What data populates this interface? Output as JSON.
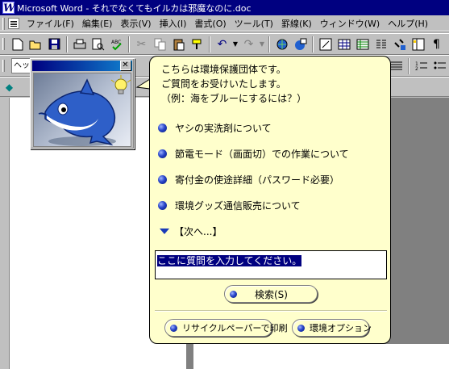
{
  "window": {
    "title": "Microsoft Word - それでなくてもイルカは邪魔なのに.doc",
    "app_icon": "W"
  },
  "menu": {
    "items": [
      "ファイル(F)",
      "編集(E)",
      "表示(V)",
      "挿入(I)",
      "書式(O)",
      "ツール(T)",
      "罫線(K)",
      "ウィンドウ(W)",
      "ヘルプ(H)"
    ]
  },
  "toolbar": {
    "style_value": "ヘッダ"
  },
  "balloon": {
    "intro_lines": [
      "こちらは環境保護団体です。",
      "ご質問をお受けいたします。",
      "（例：海をブルーにするには？）"
    ],
    "topics": [
      "ヤシの実洗剤について",
      "節電モード（画面切）での作業について",
      "寄付金の使途詳細（パスワード必要）",
      "環境グッズ通信販売について"
    ],
    "next_label": "【次へ...】",
    "question_input": "ここに質問を入力してください。",
    "search_label": "検索(S)",
    "print_label": "リサイクルペーパーで印刷",
    "options_label": "環境オプション"
  },
  "colors": {
    "title_bar": "#000080",
    "balloon_bg": "#ffffcc",
    "bullet": "#1a3bb8",
    "dolphin": "#2e5fc8"
  }
}
